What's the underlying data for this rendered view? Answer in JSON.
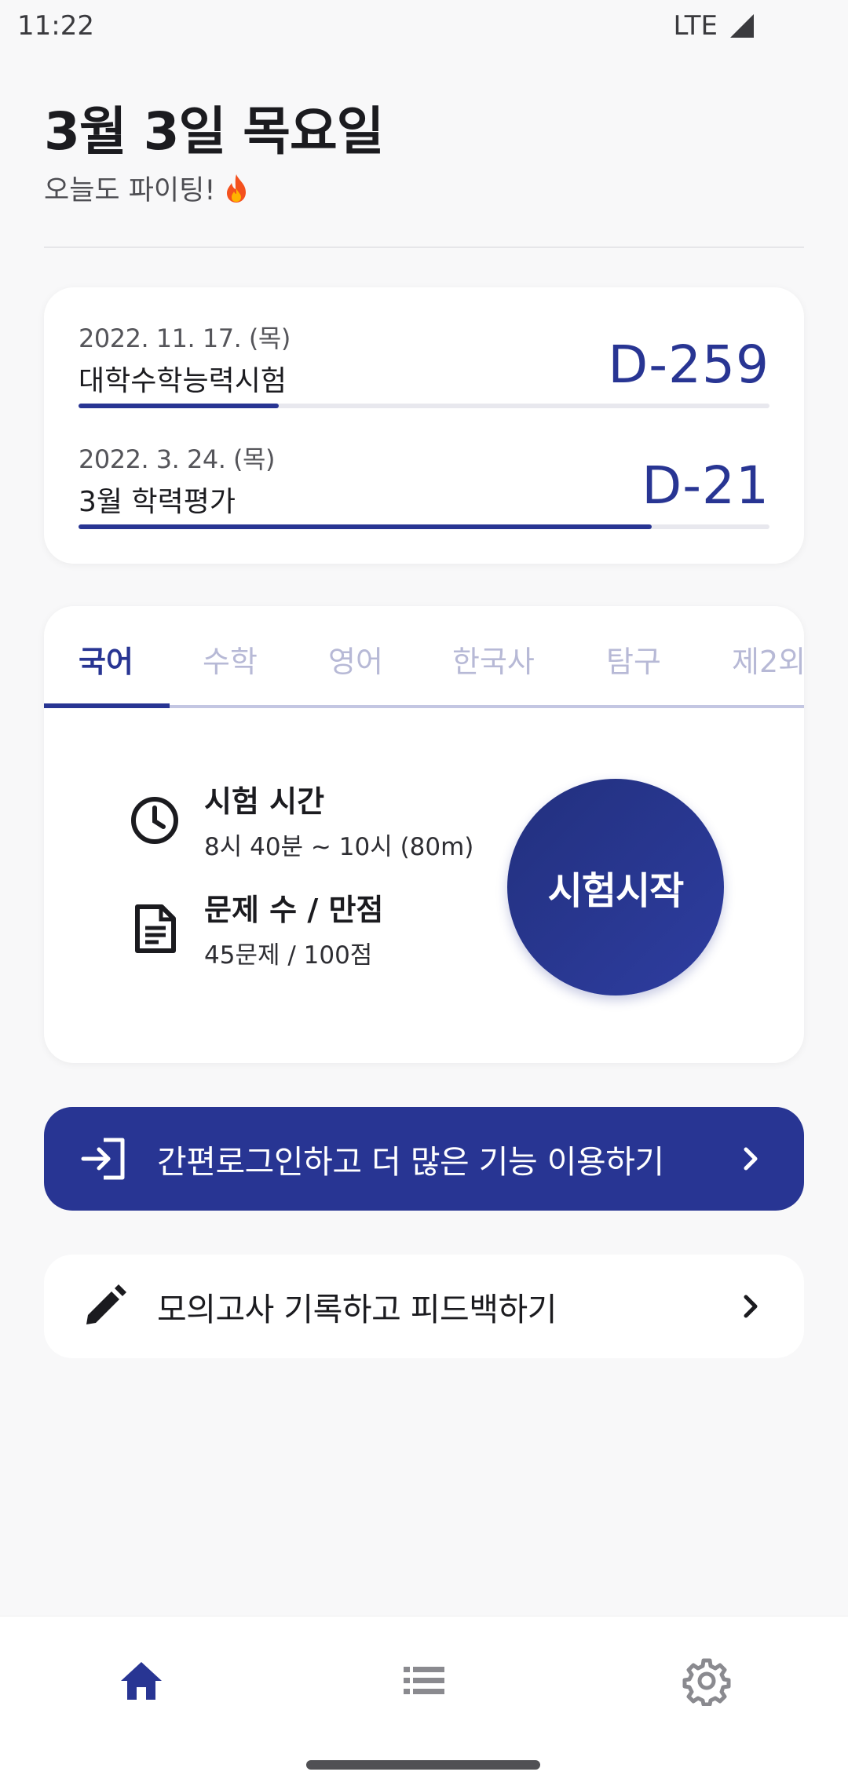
{
  "status_bar": {
    "time": "11:22",
    "network": "LTE"
  },
  "header": {
    "date_title": "3월 3일 목요일",
    "subtitle": "오늘도 파이팅!"
  },
  "ddays": [
    {
      "date": "2022. 11. 17. (목)",
      "name": "대학수학능력시험",
      "count": "D-259",
      "progress": 0.29
    },
    {
      "date": "2022. 3. 24. (목)",
      "name": "3월 학력평가",
      "count": "D-21",
      "progress": 0.83
    }
  ],
  "subject_tabs": [
    {
      "label": "국어",
      "active": true
    },
    {
      "label": "수학",
      "active": false
    },
    {
      "label": "영어",
      "active": false
    },
    {
      "label": "한국사",
      "active": false
    },
    {
      "label": "탐구",
      "active": false
    },
    {
      "label": "제2외",
      "active": false
    }
  ],
  "exam_info": {
    "time_title": "시험 시간",
    "time_value": "8시 40분 ~ 10시 (80m)",
    "questions_title": "문제 수 / 만점",
    "questions_value": "45문제 / 100점",
    "start_label": "시험시작"
  },
  "banners": {
    "login": "간편로그인하고 더 많은 기능 이용하기",
    "record": "모의고사 기록하고 피드백하기"
  },
  "bottom_nav": {
    "items": [
      "home-icon",
      "list-icon",
      "settings-icon"
    ],
    "active": "home-icon"
  },
  "colors": {
    "primary": "#283593",
    "tab_inactive": "#b7b9d6",
    "background": "#f8f8f9"
  }
}
